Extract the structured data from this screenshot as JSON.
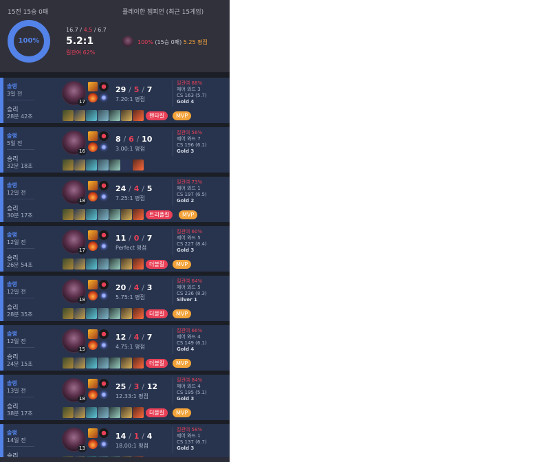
{
  "summary": {
    "record": "15전 15승 0패",
    "champ_header": "플레이한 챔피언 (최근 15게임)",
    "winrate": "100%",
    "kills": "16.7",
    "deaths": "4.5",
    "assists": "6.7",
    "sep": "/",
    "kda_ratio": "5.2:1",
    "kill_participation": "킬관여 62%",
    "champ_winrate": "100%",
    "champ_record": "(15승 0패)",
    "champ_avg": "5.25 평점"
  },
  "matches": [
    {
      "mode": "솔랭",
      "ago": "3일 전",
      "result": "승리",
      "duration": "28분 42초",
      "level": "17",
      "k": "29",
      "d": "5",
      "a": "7",
      "ratio": "7.20:1 평점",
      "kp": "킬관여 88%",
      "wards": "제어 와드 3",
      "cs": "CS 163 (5.7)",
      "tier": "Gold 4",
      "badges": [
        "펜타킬",
        "MVP"
      ]
    },
    {
      "mode": "솔랭",
      "ago": "5일 전",
      "result": "승리",
      "duration": "32분 18초",
      "level": "16",
      "k": "8",
      "d": "6",
      "a": "10",
      "ratio": "3.00:1 평점",
      "kp": "킬관여 56%",
      "wards": "제어 와드 7",
      "cs": "CS 196 (6.1)",
      "tier": "Gold 3",
      "badges": []
    },
    {
      "mode": "솔랭",
      "ago": "12일 전",
      "result": "승리",
      "duration": "30분 17초",
      "level": "18",
      "k": "24",
      "d": "4",
      "a": "5",
      "ratio": "7.25:1 평점",
      "kp": "킬관여 73%",
      "wards": "제어 와드 1",
      "cs": "CS 197 (6.5)",
      "tier": "Gold 2",
      "badges": [
        "트리플킬",
        "MVP"
      ]
    },
    {
      "mode": "솔랭",
      "ago": "12일 전",
      "result": "승리",
      "duration": "26분 54초",
      "level": "17",
      "k": "11",
      "d": "0",
      "a": "7",
      "ratio": "Perfect 평점",
      "kp": "킬관여 60%",
      "wards": "제어 와드 5",
      "cs": "CS 227 (8.4)",
      "tier": "Gold 3",
      "badges": [
        "더블킬",
        "MVP"
      ]
    },
    {
      "mode": "솔랭",
      "ago": "12일 전",
      "result": "승리",
      "duration": "28분 35초",
      "level": "18",
      "k": "20",
      "d": "4",
      "a": "3",
      "ratio": "5.75:1 평점",
      "kp": "킬관여 64%",
      "wards": "제어 와드 5",
      "cs": "CS 236 (8.3)",
      "tier": "Silver 1",
      "badges": [
        "더블킬",
        "MVP"
      ]
    },
    {
      "mode": "솔랭",
      "ago": "12일 전",
      "result": "승리",
      "duration": "24분 15초",
      "level": "15",
      "k": "12",
      "d": "4",
      "a": "7",
      "ratio": "4.75:1 평점",
      "kp": "킬관여 66%",
      "wards": "제어 와드 4",
      "cs": "CS 149 (6.1)",
      "tier": "Gold 4",
      "badges": [
        "더블킬",
        "MVP"
      ]
    },
    {
      "mode": "솔랭",
      "ago": "13일 전",
      "result": "승리",
      "duration": "38분 17초",
      "level": "18",
      "k": "25",
      "d": "3",
      "a": "12",
      "ratio": "12.33:1 평점",
      "kp": "킬관여 84%",
      "wards": "제어 와드 4",
      "cs": "CS 195 (5.1)",
      "tier": "Gold 3",
      "badges": [
        "더블킬",
        "MVP"
      ]
    },
    {
      "mode": "솔랭",
      "ago": "14일 전",
      "result": "승리",
      "duration": "",
      "level": "13",
      "k": "14",
      "d": "1",
      "a": "4",
      "ratio": "18.00:1 평점",
      "kp": "킬관여 58%",
      "wards": "제어 와드 1",
      "cs": "CS 137 (6.7)",
      "tier": "Gold 3",
      "badges": []
    }
  ],
  "colors": {
    "win": "#5383e8",
    "loss": "#e84057",
    "mvp": "#f2a33a"
  }
}
